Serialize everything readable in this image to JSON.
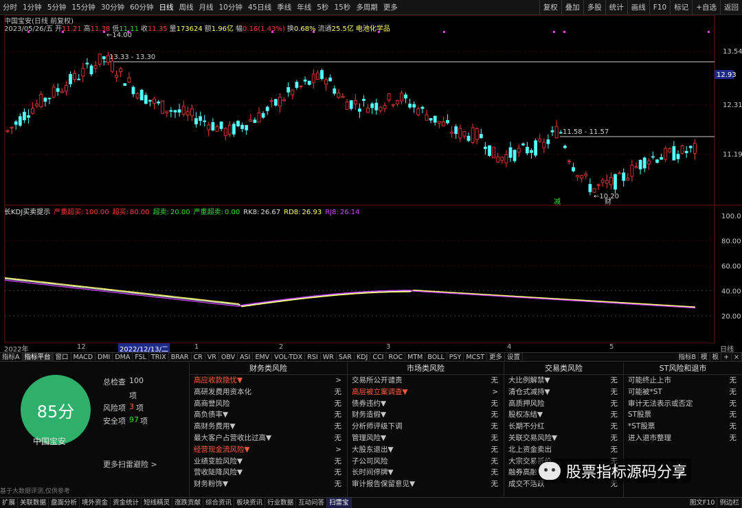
{
  "toolbar": {
    "left_items": [
      "分时",
      "1分钟",
      "5分钟",
      "15分钟",
      "30分钟",
      "60分钟",
      "日线",
      "周线",
      "月线",
      "10分钟",
      "45日线",
      "季线",
      "年线",
      "5秒",
      "15秒",
      "多周期",
      "更多"
    ],
    "active_item": "日线",
    "right_items": [
      "复权",
      "叠加",
      "多股",
      "统计",
      "画线",
      "F10",
      "标记",
      "+自选",
      "返回"
    ]
  },
  "quote": {
    "title": "中国宝安(日线 前复权)",
    "date": "2023/05/26/五",
    "open_label": "开",
    "open": "11.21",
    "high_label": "高",
    "high": "11.38",
    "low_label": "低",
    "low": "11.11",
    "close_label": "收",
    "close": "11.35",
    "volume_label": "量",
    "volume": "173624",
    "amount_label": "额",
    "amount": "1.96亿",
    "change_label": "幅",
    "change": "0.16(1.43%)",
    "turnover_label": "换",
    "turnover": "0.68%",
    "float_label": "流通",
    "float_cap": "25.5亿",
    "sector": "电池化学品"
  },
  "price_axis": {
    "ticks": [
      "13.54",
      "12.31",
      "11.19"
    ],
    "current": "12.93",
    "annotations": [
      "14.00",
      "13.33 - 13.30",
      "11.58 - 11.57",
      "10.20"
    ],
    "markers": [
      "减",
      "财"
    ]
  },
  "kdj": {
    "title": "长KDJ买卖提示",
    "params": [
      {
        "label": "严重超买:",
        "value": "100.00",
        "color": "#ff3a3a"
      },
      {
        "label": "超买:",
        "value": "80.00",
        "color": "#ff3a3a"
      },
      {
        "label": "超卖:",
        "value": "20.00",
        "color": "#33dd33"
      },
      {
        "label": "严重超卖:",
        "value": "0.00",
        "color": "#33dd33"
      },
      {
        "label": "RK8:",
        "value": "26.67",
        "color": "#e0e0e0"
      },
      {
        "label": "RD8:",
        "value": "26.93",
        "color": "#ffff66"
      },
      {
        "label": "RJ8:",
        "value": "26.14",
        "color": "#cc44ff"
      }
    ],
    "axis_ticks": [
      "100.0",
      "80.00",
      "60.00",
      "40.00",
      "20.00"
    ]
  },
  "date_axis": {
    "labels": [
      "2022年",
      "12",
      "2022/12/13/二",
      "1",
      "2",
      "3",
      "4",
      "5"
    ],
    "period": "日线"
  },
  "indicator_tabs": {
    "items": [
      "指标A",
      "指标平台",
      "窗口",
      "MACD",
      "DMI",
      "DMA",
      "FSL",
      "TRIX",
      "BRAR",
      "CR",
      "VR",
      "OBV",
      "ASI",
      "EMV",
      "VOL-TDX",
      "RSI",
      "WR",
      "SAR",
      "KDJ",
      "CCI",
      "ROC",
      "MTM",
      "BOLL",
      "PSY",
      "MCST",
      "更多",
      "设置"
    ],
    "active": "指标平台",
    "right_items": [
      "指标B",
      "模",
      "板",
      "+",
      "×"
    ]
  },
  "summary": {
    "score": "85分",
    "stock": "中国宝安",
    "total_label": "总检查",
    "total": "100",
    "total_unit": "项",
    "risk_label": "风险项",
    "risk": "3",
    "risk_unit": "项",
    "safe_label": "安全项",
    "safe": "97",
    "safe_unit": "项",
    "more": "更多扫雷避险 >",
    "disclaimer": "基于大数据评测,仅供参考"
  },
  "risk_columns": [
    {
      "header": "财务类风险",
      "rows": [
        {
          "label": "高应收款隐忧▼",
          "value": ">",
          "alert": true
        },
        {
          "label": "高研发费用资本化",
          "value": "无"
        },
        {
          "label": "高商誉风险",
          "value": "无"
        },
        {
          "label": "高负债率▼",
          "value": "无"
        },
        {
          "label": "高财务费用▼",
          "value": "无"
        },
        {
          "label": "最大客户占营收比过高▼",
          "value": "无"
        },
        {
          "label": "经营现金流风险▼",
          "value": ">",
          "alert": true
        },
        {
          "label": "业绩变脸风险▼",
          "value": "无"
        },
        {
          "label": "营收陡降风险▼",
          "value": "无"
        },
        {
          "label": "财务粉饰▼",
          "value": "无"
        }
      ]
    },
    {
      "header": "市场类风险",
      "rows": [
        {
          "label": "交易所公开谴责",
          "value": "无"
        },
        {
          "label": "高层被立案调查▼",
          "value": ">",
          "alert": true
        },
        {
          "label": "债券违约▼",
          "value": "无"
        },
        {
          "label": "财务造假▼",
          "value": "无"
        },
        {
          "label": "分析师评级下调",
          "value": "无"
        },
        {
          "label": "管理风险▼",
          "value": "无"
        },
        {
          "label": "大股东退出▼",
          "value": "无"
        },
        {
          "label": "子公司风险",
          "value": "无"
        },
        {
          "label": "长时间停牌▼",
          "value": "无"
        },
        {
          "label": "审计报告保留意见▼",
          "value": "无"
        }
      ]
    },
    {
      "header": "交易类风险",
      "rows": [
        {
          "label": "大比例解禁▼",
          "value": "无"
        },
        {
          "label": "清仓式减持▼",
          "value": "无"
        },
        {
          "label": "高质押风险",
          "value": "无"
        },
        {
          "label": "股权冻结▼",
          "value": "无"
        },
        {
          "label": "长期不分红",
          "value": "无"
        },
        {
          "label": "关联交易风险▼",
          "value": "无"
        },
        {
          "label": "北上资金卖出",
          "value": "无"
        },
        {
          "label": "大宗交易折价",
          "value": "无"
        },
        {
          "label": "融券高融",
          "value": "无"
        },
        {
          "label": "成交不活跃",
          "value": "无"
        }
      ]
    },
    {
      "header": "ST风险和退市",
      "rows": [
        {
          "label": "可能终止上市",
          "value": "无"
        },
        {
          "label": "可能被*ST",
          "value": "无"
        },
        {
          "label": "审计无法表示或否定",
          "value": "无"
        },
        {
          "label": "ST股票",
          "value": "无"
        },
        {
          "label": "*ST股票",
          "value": "无"
        },
        {
          "label": "进入退市整理",
          "value": "无"
        }
      ]
    }
  ],
  "watermark": "股票指标源码分享",
  "bottom_tabs": {
    "items": [
      "扩展",
      "关联数据",
      "盘面分析",
      "境外资金",
      "资金统计",
      "短线精灵",
      "涨跌贡献",
      "综合资讯",
      "板块资讯",
      "行业数据",
      "互动问答",
      "扫雷宝"
    ],
    "active": "扫雷宝",
    "right_items": [
      "图文F10",
      "例边栏"
    ]
  },
  "colors": {
    "up": "#ff3a3a",
    "down": "#54ffff",
    "kdj_k": "#e0e0e0",
    "kdj_d": "#ffff66",
    "kdj_j": "#cc44ff"
  }
}
